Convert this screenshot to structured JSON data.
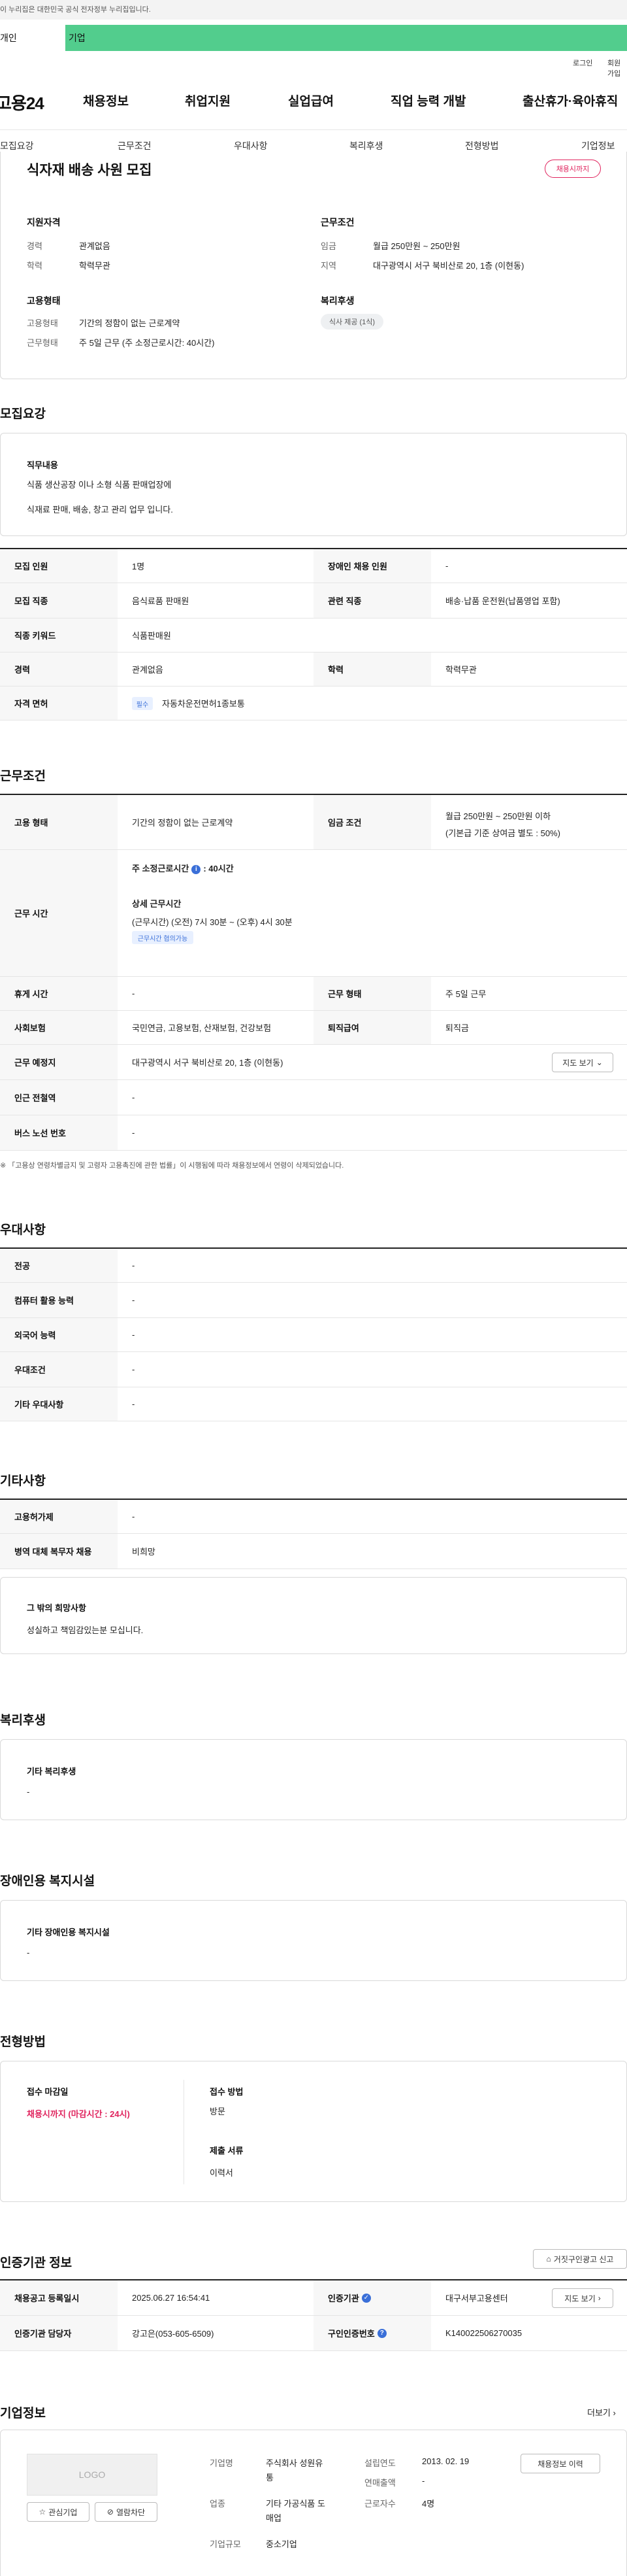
{
  "gov_bar": {
    "text": "이 누리집은 대한민국 공식 전자정부 누리집입니다."
  },
  "top_tabs": {
    "individual": "개인",
    "corporate": "기업"
  },
  "util": {
    "login": "로그인",
    "join": "회원가입"
  },
  "gnb": {
    "logo": "고용24",
    "items": [
      "채용정보",
      "취업지원",
      "실업급여",
      "직업 능력 개발",
      "출산휴가·육아휴직"
    ]
  },
  "lnb": [
    "모집요강",
    "근무조건",
    "우대사항",
    "복리후생",
    "전형방법",
    "기업정보"
  ],
  "summary": {
    "title": "식자재 배송 사원 모집",
    "badge": "채용시까지",
    "qual_title": "지원자격",
    "career_label": "경력",
    "career_value": "관계없음",
    "edu_label": "학력",
    "edu_value": "학력무관",
    "emp_title": "고용형태",
    "emp_label": "고용형태",
    "emp_value": "기간의 정함이 없는 근로계약",
    "work_label": "근무형태",
    "work_value": "주 5일 근무 (주 소정근로시간: 40시간)",
    "cond_title": "근무조건",
    "wage_label": "임금",
    "wage_value": "월급 250만원 ~ 250만원",
    "area_label": "지역",
    "area_value": "대구광역시 서구 북비산로 20, 1층 (이현동)",
    "welfare_title": "복리후생",
    "welfare_tag": "식사 제공 (1식)"
  },
  "recruit": {
    "heading": "모집요강",
    "duty_title": "직무내용",
    "duty_line1": "식품 생산공장 이나 소형 식품 판매업장에",
    "duty_line2": "식재료 판매, 배송, 창고 관리 업무 입니다.",
    "rows": {
      "count_label": "모집 인원",
      "count_value": "1명",
      "disabled_label": "장애인 채용 인원",
      "disabled_value": "-",
      "job_label": "모집 직종",
      "job_value": "음식료품 판매원",
      "related_label": "관련 직종",
      "related_value": "배송·납품 운전원(납품영업 포함)",
      "keyword_label": "직종 키워드",
      "keyword_value": "식품판매원",
      "career_label": "경력",
      "career_value": "관계없음",
      "edu_label": "학력",
      "edu_value": "학력무관",
      "license_label": "자격 면허",
      "license_tag": "필수",
      "license_value": "자동차운전면허1종보통"
    }
  },
  "conditions": {
    "heading": "근무조건",
    "emp_label": "고용 형태",
    "emp_value": "기간의 정함이 없는 근로계약",
    "wage_label": "임금 조건",
    "wage_value1": "월급 250만원 ~ 250만원 이하",
    "wage_value2": "(기본급 기준 상여금 별도 : 50%)",
    "hours_label": "근무 시간",
    "hours_weekly": "주 소정근로시간",
    "hours_weekly_value": ": 40시간",
    "hours_detail_title": "상세 근무시간",
    "hours_detail": "(근무시간) (오전) 7시 30분 ~ (오후) 4시 30분",
    "hours_tag": "근무시간 협의가능",
    "rest_label": "휴게 시간",
    "rest_value": "-",
    "worktype_label": "근무 형태",
    "worktype_value": "주 5일 근무",
    "insurance_label": "사회보험",
    "insurance_value": "국민연금, 고용보험, 산재보험, 건강보험",
    "severance_label": "퇴직급여",
    "severance_value": "퇴직금",
    "place_label": "근무 예정지",
    "place_value": "대구광역시 서구 북비산로 20, 1층 (이현동)",
    "map_button": "지도 보기",
    "subway_label": "인근 전철역",
    "subway_value": "-",
    "bus_label": "버스 노선 번호",
    "bus_value": "-",
    "notice": "「고용상 연령차별금지 및 고령자 고용촉진에 관한 법률」이 시행됨에 따라 채용정보에서 연령이 삭제되었습니다."
  },
  "preferences": {
    "heading": "우대사항",
    "rows": [
      {
        "label": "전공",
        "value": "-"
      },
      {
        "label": "컴퓨터 활용 능력",
        "value": "-"
      },
      {
        "label": "외국어 능력",
        "value": "-"
      },
      {
        "label": "우대조건",
        "value": "-"
      },
      {
        "label": "기타 우대사항",
        "value": "-"
      }
    ]
  },
  "others": {
    "heading": "기타사항",
    "equip_label": "고용허가제",
    "equip_value": "-",
    "military_label": "병역 대체 복무자 채용",
    "military_value": "비희망",
    "wish_title": "그 밖의 희망사항",
    "wish_value": "성실하고 책임감있는분 모십니다."
  },
  "welfare": {
    "heading": "복리후생",
    "title": "기타 복리후생",
    "value": "-"
  },
  "disability": {
    "heading": "장애인용 복지시설",
    "title": "기타 장애인용 복지시설",
    "value": "-"
  },
  "selection": {
    "heading": "전형방법",
    "deadline_title": "접수 마감일",
    "deadline_value": "채용시까지 (마감시간 : 24시)",
    "method_title": "접수 방법",
    "method_value": "방문",
    "docs_title": "제출 서류",
    "docs_value": "이력서"
  },
  "agency": {
    "heading": "인증기관 정보",
    "report_button": "거짓구인광고 신고",
    "reg_label": "채용공고 등록일시",
    "reg_value": "2025.06.27 16:54:41",
    "agency_label": "인증기관",
    "agency_value": "대구서부고용센터",
    "map_button": "지도 보기",
    "manager_label": "인증기관 담당자",
    "manager_value": "강고은(053-605-6509)",
    "number_label": "구인인증번호",
    "number_value": "K140022506270035"
  },
  "company": {
    "heading": "기업정보",
    "more": "더보기",
    "logo_text": "LOGO",
    "fav_button": "관심기업",
    "block_button": "열람차단",
    "name_label": "기업명",
    "name_value1": "주식회사 성원유",
    "name_value2": "통",
    "industry_label": "업종",
    "industry_value1": "기타 가공식품 도",
    "industry_value2": "매업",
    "size_label": "기업규모",
    "size_value": "중소기업",
    "founded_label": "설립연도",
    "founded_value": "2013. 02. 19",
    "revenue_label": "연매출액",
    "revenue_value": "-",
    "staff_label": "근로자수",
    "staff_value": "4명",
    "history_button": "채용정보 이력"
  }
}
